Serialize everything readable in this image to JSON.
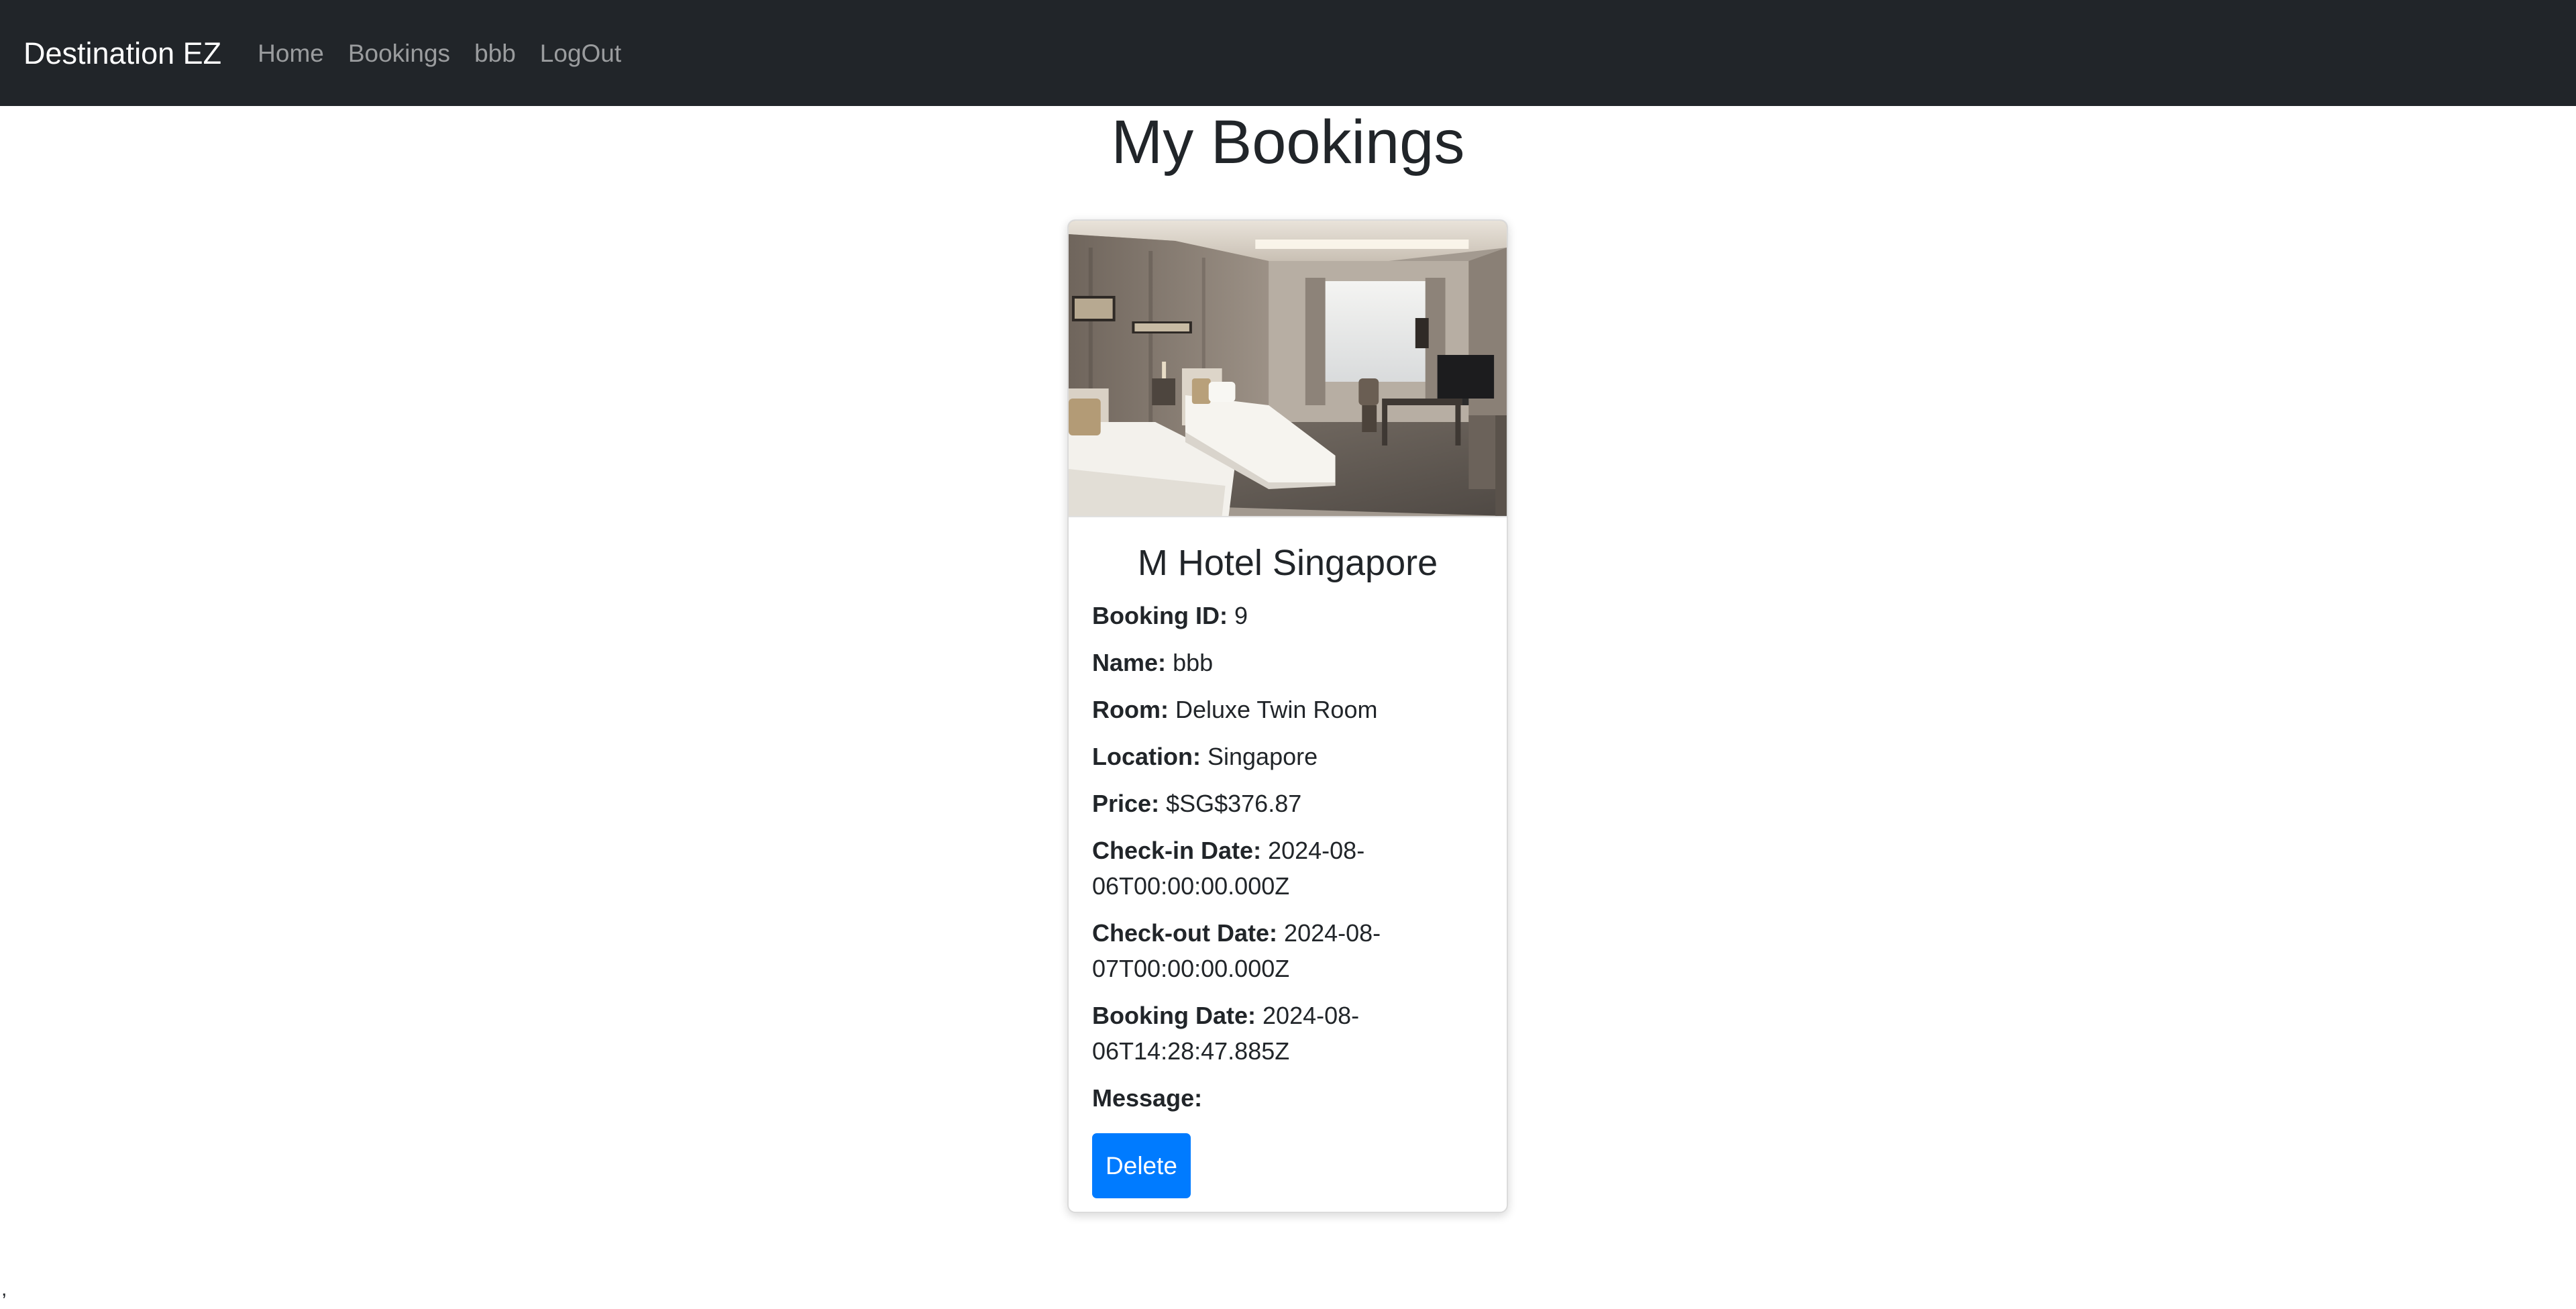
{
  "navbar": {
    "brand": "Destination EZ",
    "links": [
      "Home",
      "Bookings",
      "bbb",
      "LogOut"
    ]
  },
  "page": {
    "title": "My Bookings",
    "stray_text": ","
  },
  "booking": {
    "hotel_name": "M Hotel Singapore",
    "fields": [
      {
        "label": "Booking ID:",
        "value": "9"
      },
      {
        "label": "Name:",
        "value": "bbb"
      },
      {
        "label": "Room:",
        "value": "Deluxe Twin Room"
      },
      {
        "label": "Location:",
        "value": "Singapore"
      },
      {
        "label": "Price:",
        "value": "$SG$376.87"
      },
      {
        "label": "Check-in Date:",
        "value": "2024-08-06T00:00:00.000Z"
      },
      {
        "label": "Check-out Date:",
        "value": "2024-08-07T00:00:00.000Z"
      },
      {
        "label": "Booking Date:",
        "value": "2024-08-06T14:28:47.885Z"
      },
      {
        "label": "Message:",
        "value": ""
      }
    ],
    "delete_label": "Delete",
    "image_icon": "hotel-room-photo"
  },
  "colors": {
    "navbar_bg": "#212529",
    "button_primary": "#007bff"
  }
}
